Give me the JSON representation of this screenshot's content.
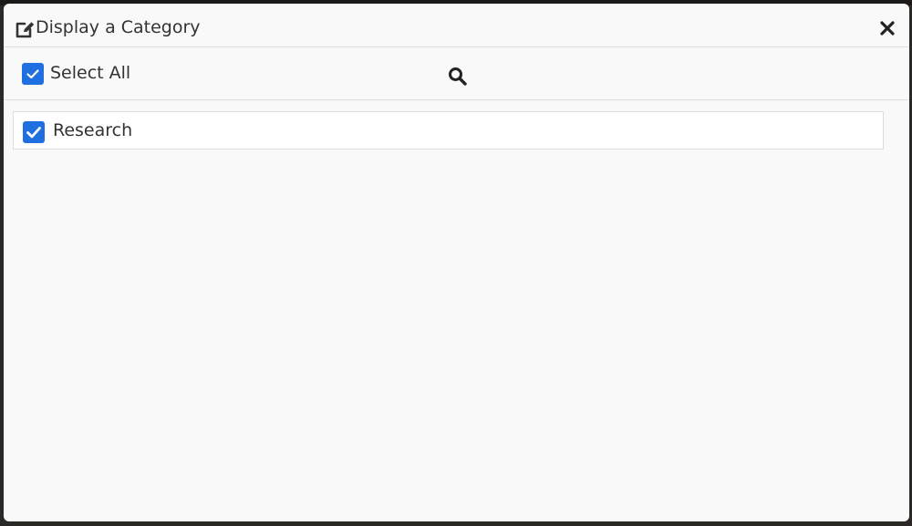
{
  "dialog": {
    "title": "Display a Category",
    "title_icon": "edit-icon",
    "close_icon": "close-icon"
  },
  "toolbar": {
    "select_all_label": "Select All",
    "select_all_checked": true,
    "search_icon": "search-icon"
  },
  "categories": [
    {
      "label": "Research",
      "checked": true
    }
  ],
  "colors": {
    "checkbox": "#1f6fe0",
    "modal_bg": "#f9f9f9",
    "text": "#333333",
    "backdrop": "#2b2926"
  }
}
